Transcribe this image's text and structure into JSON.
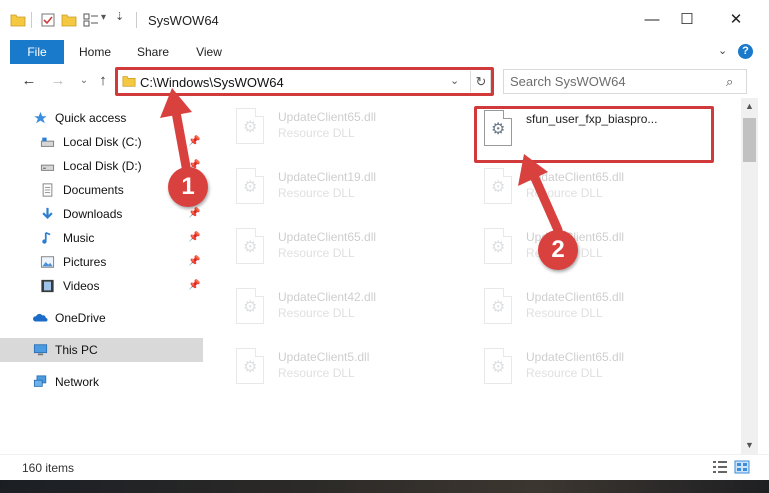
{
  "window": {
    "title": "SysWOW64",
    "minimize_glyph": "—",
    "maximize_glyph": "☐",
    "close_glyph": "✕"
  },
  "ribbon": {
    "tabs": [
      "File",
      "Home",
      "Share",
      "View"
    ],
    "help": "?"
  },
  "address": {
    "path": "C:\\Windows\\SysWOW64",
    "search_placeholder": "Search SysWOW64"
  },
  "nav": {
    "items": [
      {
        "label": "Quick access",
        "icon": "star-icon",
        "pinned": false
      },
      {
        "label": "Local Disk (C:)",
        "icon": "drive-icon",
        "pinned": true
      },
      {
        "label": "Local Disk (D:)",
        "icon": "drive-icon",
        "pinned": true
      },
      {
        "label": "Documents",
        "icon": "documents-icon",
        "pinned": true
      },
      {
        "label": "Downloads",
        "icon": "download-icon",
        "pinned": true
      },
      {
        "label": "Music",
        "icon": "music-icon",
        "pinned": true
      },
      {
        "label": "Pictures",
        "icon": "pictures-icon",
        "pinned": true
      },
      {
        "label": "Videos",
        "icon": "videos-icon",
        "pinned": true
      },
      {
        "label": "OneDrive",
        "icon": "onedrive-icon",
        "pinned": false
      },
      {
        "label": "This PC",
        "icon": "pc-icon",
        "pinned": false,
        "selected": true
      },
      {
        "label": "Network",
        "icon": "network-icon",
        "pinned": false
      }
    ]
  },
  "files": {
    "left_column": [
      {
        "name": "UpdateClient65.dll",
        "type": "Resource DLL"
      },
      {
        "name": "UpdateClient19.dll",
        "type": "Resource DLL"
      },
      {
        "name": "UpdateClient65.dll",
        "type": "Resource DLL"
      },
      {
        "name": "UpdateClient42.dll",
        "type": "Resource DLL"
      },
      {
        "name": "UpdateClient5.dll",
        "type": "Resource DLL"
      }
    ],
    "right_column": [
      {
        "name": "sfun_user_fxp_biaspro...",
        "type": ""
      },
      {
        "name": "UpdateClient65.dll",
        "type": "Resource DLL"
      },
      {
        "name": "UpdateClient65.dll",
        "type": "Resource DLL"
      },
      {
        "name": "UpdateClient65.dll",
        "type": "Resource DLL"
      },
      {
        "name": "UpdateClient65.dll",
        "type": "Resource DLL"
      }
    ]
  },
  "status": {
    "item_count": "160 items"
  },
  "annotations": {
    "step1": "1",
    "step2": "2",
    "color": "#d9413f"
  }
}
